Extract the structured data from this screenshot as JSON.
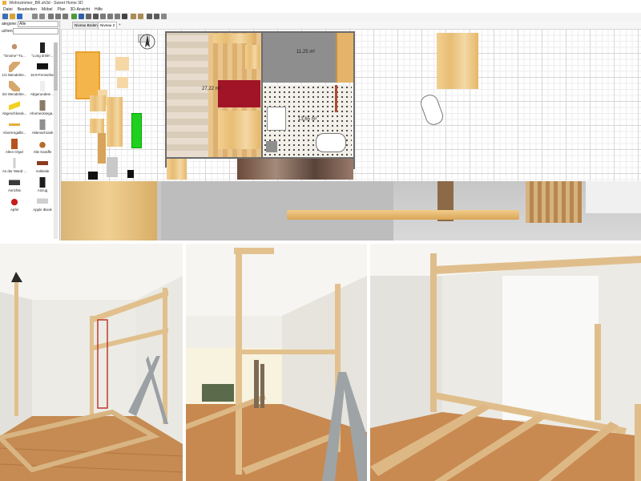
{
  "window": {
    "title": "Wohnzimmer_BR.sh3d - Sweet Home 3D"
  },
  "menu": [
    "Datei",
    "Bearbeiten",
    "Möbel",
    "Plan",
    "3D-Ansicht",
    "Hilfe"
  ],
  "catalog": {
    "category_label": "ategorie:",
    "category_value": "Alle",
    "search_label": "uchen:",
    "items": [
      {
        "label": "\"Gnome\"-Tu...",
        "icon": "gnome-figure-icon"
      },
      {
        "label": "\"Long drink\"...",
        "icon": "long-drink-glass-icon"
      },
      {
        "label": "1/4 Wendeltre...",
        "icon": "spiral-stair-icon"
      },
      {
        "label": "16:9-Fernseher",
        "icon": "tv-icon"
      },
      {
        "label": "3/4 Wendeltre...",
        "icon": "spiral-stair-icon"
      },
      {
        "label": "Abgerundete ...",
        "icon": "rounded-cabinet-icon"
      },
      {
        "label": "Abgeschlossk...",
        "icon": "cheese-icon"
      },
      {
        "label": "Ahornecksega...",
        "icon": "corner-shelf-icon"
      },
      {
        "label": "Ahornregalbr...",
        "icon": "shelf-board-icon"
      },
      {
        "label": "Aktenschrank",
        "icon": "file-cabinet-icon"
      },
      {
        "label": "Alten Orgel",
        "icon": "organ-icon"
      },
      {
        "label": "Alte Karaffe",
        "icon": "carafe-icon"
      },
      {
        "label": "An der Wand ...",
        "icon": "wall-lamp-icon"
      },
      {
        "label": "Ankleide",
        "icon": "dresser-icon"
      },
      {
        "label": "Anrichte",
        "icon": "sideboard-icon"
      },
      {
        "label": "Anzug",
        "icon": "suit-icon"
      },
      {
        "label": "Apfel",
        "icon": "apple-bowl-icon"
      },
      {
        "label": "Apple iBook",
        "icon": "laptop-icon"
      }
    ]
  },
  "plan": {
    "tabs": [
      "Niveau Boden",
      "Niveau 2"
    ],
    "add_tab": "+",
    "room_areas": [
      "27,22 m²",
      "11,25 m²",
      "13,65 m²"
    ]
  },
  "colors": {
    "wood": "#e8bd74",
    "wall": "#6c6c6c",
    "red_furniture": "#a11326",
    "green_furniture": "#1fd01f",
    "grid_line": "#d7d7d7"
  }
}
